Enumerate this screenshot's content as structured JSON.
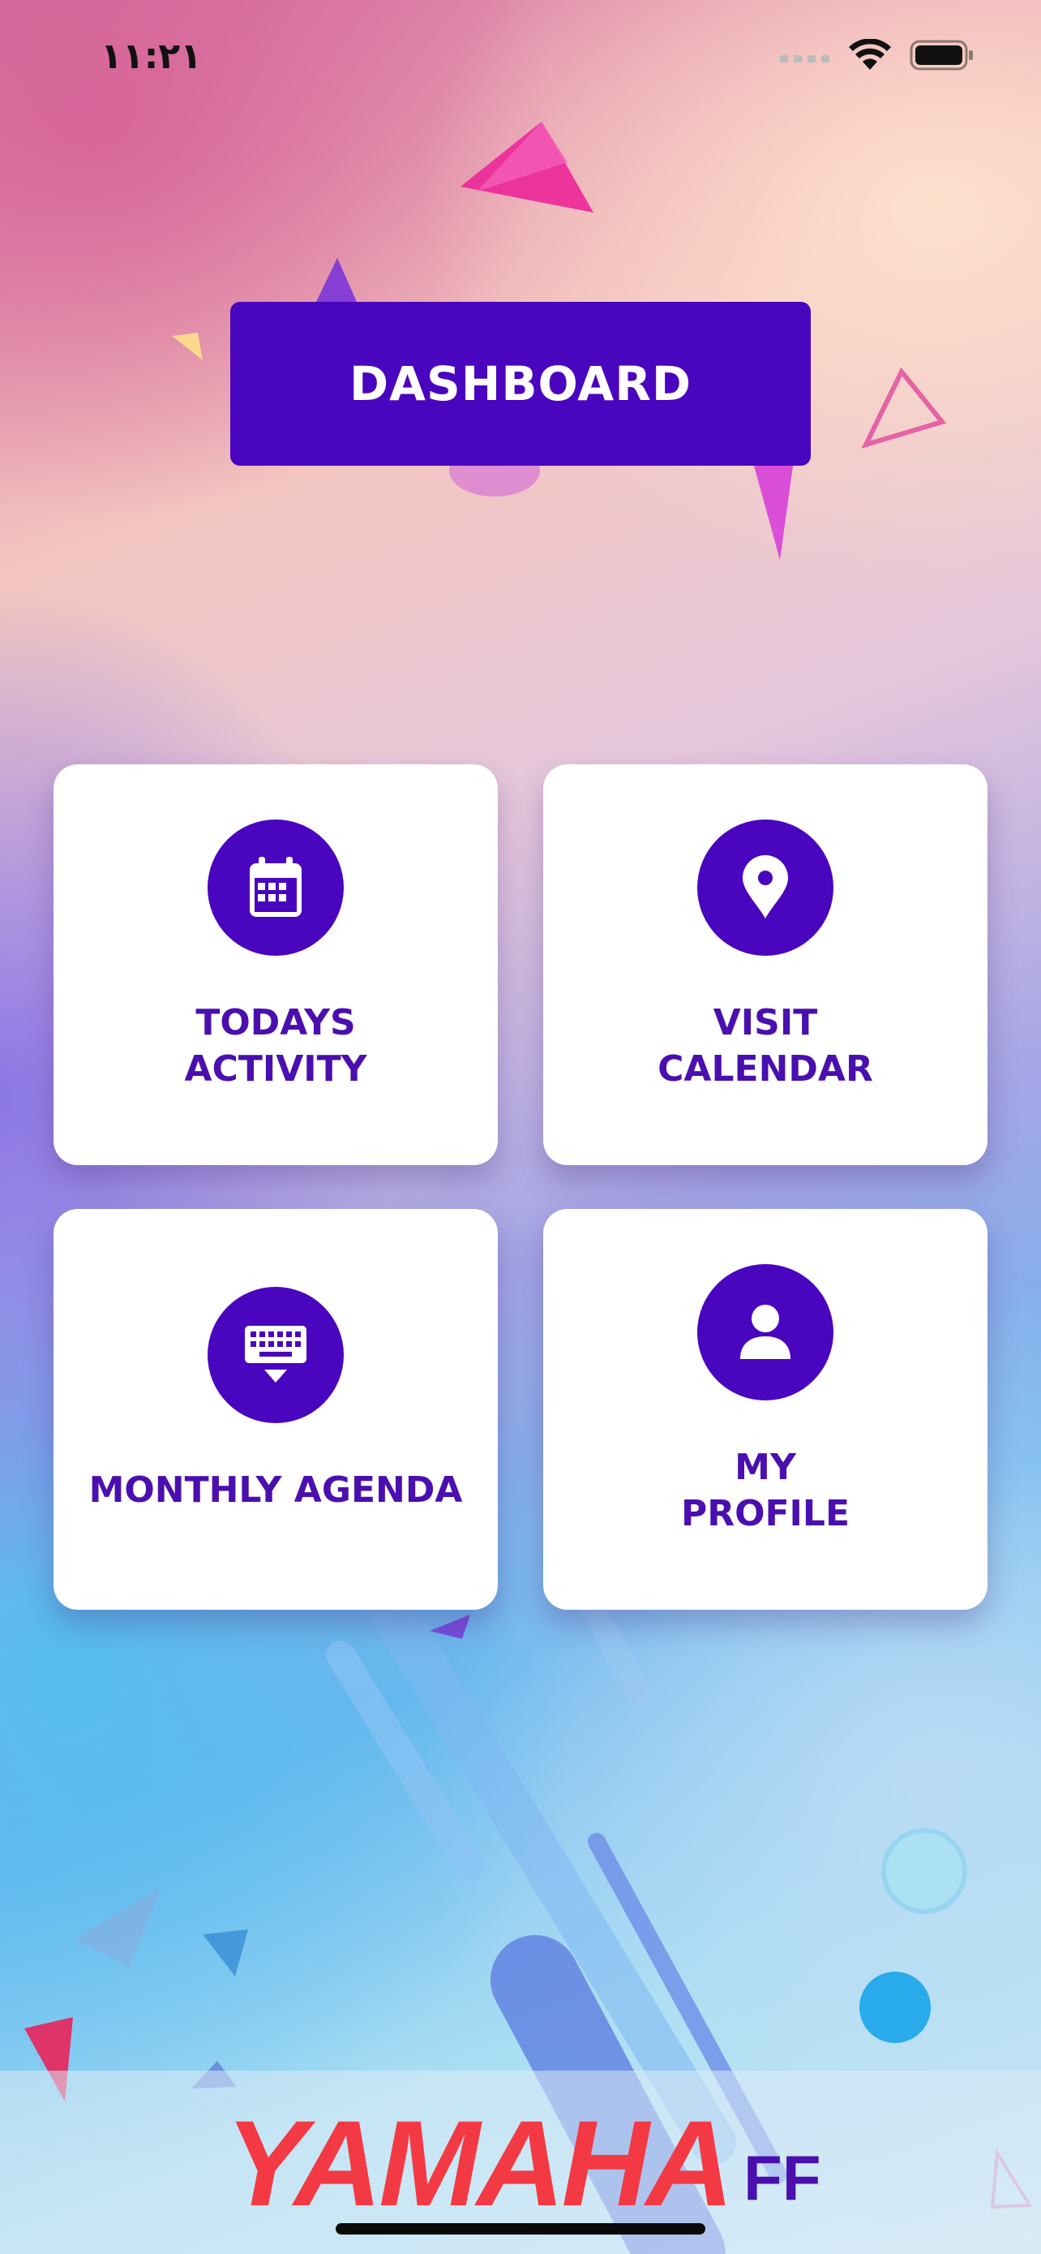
{
  "status_bar": {
    "time": "١١:٢١",
    "signal_icon": "cellular-signal-icon",
    "wifi_icon": "wifi-icon",
    "battery_icon": "battery-icon"
  },
  "header": {
    "dashboard_label": "DASHBOARD"
  },
  "menu": [
    {
      "label": "TODAYS\nACTIVITY",
      "icon": "calendar-icon"
    },
    {
      "label": "VISIT\nCALENDAR",
      "icon": "location-pin-icon"
    },
    {
      "label": "MONTHLY AGENDA",
      "icon": "keyboard-icon"
    },
    {
      "label": "MY\nPROFILE",
      "icon": "person-icon"
    }
  ],
  "footer": {
    "logo_main": "YAMAHA",
    "logo_sub": "FF"
  },
  "colors": {
    "primary": "#4a05bf",
    "label_text": "#4a0fae",
    "logo_red": "#f33a44"
  }
}
